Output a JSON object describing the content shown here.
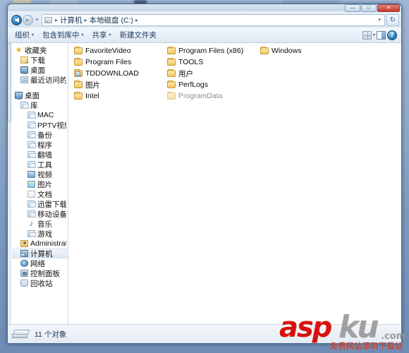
{
  "window": {
    "controls": {
      "minimize": "—",
      "maximize": "□",
      "close": "✕"
    }
  },
  "address": {
    "back_icon": "back-arrow-icon",
    "forward_icon": "forward-arrow-icon",
    "recent_caret": "▾",
    "drive_icon": "drive-icon",
    "crumbs": [
      "计算机",
      "本地磁盘 (C:)"
    ],
    "separator": "▸",
    "trailing_separator": "▸",
    "dropdown_caret": "▾",
    "refresh_label": "↻"
  },
  "toolbar": {
    "items": [
      {
        "label": "组织",
        "caret": "▾"
      },
      {
        "label": "包含到库中",
        "caret": "▾"
      },
      {
        "label": "共享",
        "caret": "▾"
      },
      {
        "label": "新建文件夹",
        "caret": ""
      }
    ],
    "view_caret": "▾",
    "help_label": "?"
  },
  "nav": {
    "items": [
      {
        "label": "收藏夹",
        "icon": "star-icon",
        "indent": 0,
        "selected": false
      },
      {
        "label": "下载",
        "icon": "download-icon",
        "indent": 1,
        "selected": false
      },
      {
        "label": "桌面",
        "icon": "monitor-icon",
        "indent": 1,
        "selected": false
      },
      {
        "label": "最近访问的位置",
        "icon": "recent-icon",
        "indent": 1,
        "selected": false
      },
      {
        "label": "__GAP__",
        "icon": "",
        "indent": 0,
        "selected": false
      },
      {
        "label": "桌面",
        "icon": "monitor-icon",
        "indent": 0,
        "selected": false
      },
      {
        "label": "库",
        "icon": "library-icon",
        "indent": 1,
        "selected": false
      },
      {
        "label": "MAC",
        "icon": "library-icon",
        "indent": 2,
        "selected": false
      },
      {
        "label": "PPTV视频",
        "icon": "library-icon",
        "indent": 2,
        "selected": false
      },
      {
        "label": "备份",
        "icon": "library-icon",
        "indent": 2,
        "selected": false
      },
      {
        "label": "程序",
        "icon": "library-icon",
        "indent": 2,
        "selected": false
      },
      {
        "label": "翻墙",
        "icon": "library-icon",
        "indent": 2,
        "selected": false
      },
      {
        "label": "工具",
        "icon": "library-icon",
        "indent": 2,
        "selected": false
      },
      {
        "label": "视频",
        "icon": "video-icon",
        "indent": 2,
        "selected": false
      },
      {
        "label": "图片",
        "icon": "picture-icon",
        "indent": 2,
        "selected": false
      },
      {
        "label": "文档",
        "icon": "document-icon",
        "indent": 2,
        "selected": false
      },
      {
        "label": "迅雷下载",
        "icon": "library-icon",
        "indent": 2,
        "selected": false
      },
      {
        "label": "移动设备",
        "icon": "library-icon",
        "indent": 2,
        "selected": false
      },
      {
        "label": "音乐",
        "icon": "music-icon",
        "indent": 2,
        "selected": false
      },
      {
        "label": "游戏",
        "icon": "library-icon",
        "indent": 2,
        "selected": false
      },
      {
        "label": "Administrator",
        "icon": "user-icon",
        "indent": 1,
        "selected": false
      },
      {
        "label": "计算机",
        "icon": "computer-icon",
        "indent": 1,
        "selected": true
      },
      {
        "label": "网络",
        "icon": "network-icon",
        "indent": 1,
        "selected": false
      },
      {
        "label": "控制面板",
        "icon": "control-panel-icon",
        "indent": 1,
        "selected": false
      },
      {
        "label": "回收站",
        "icon": "recycle-bin-icon",
        "indent": 1,
        "selected": false
      }
    ]
  },
  "files": {
    "items": [
      {
        "name": "FavoriteVideo",
        "icon": "folder-icon",
        "dimmed": false
      },
      {
        "name": "Program Files",
        "icon": "folder-icon",
        "dimmed": false
      },
      {
        "name": "TDDOWNLOAD",
        "icon": "folder-special-icon",
        "dimmed": false
      },
      {
        "name": "图片",
        "icon": "folder-icon",
        "dimmed": false
      },
      {
        "name": "Intel",
        "icon": "folder-icon",
        "dimmed": false
      },
      {
        "name": "Program Files (x86)",
        "icon": "folder-icon",
        "dimmed": false
      },
      {
        "name": "TOOLS",
        "icon": "folder-icon",
        "dimmed": false
      },
      {
        "name": "用户",
        "icon": "folder-icon",
        "dimmed": false
      },
      {
        "name": "PerfLogs",
        "icon": "folder-icon",
        "dimmed": false
      },
      {
        "name": "ProgramData",
        "icon": "folder-icon",
        "dimmed": true
      },
      {
        "name": "Windows",
        "icon": "folder-icon",
        "dimmed": false
      }
    ]
  },
  "status": {
    "text": "11 个对象",
    "drive_icon": "hard-drive-icon"
  },
  "watermark": {
    "asp": "asp",
    "ku": "ku",
    "com": ".com",
    "subtitle": "免费网站源码下载站"
  },
  "colors": {
    "accent_blue": "#2b6ea8",
    "close_red": "#c0392b",
    "folder_yellow": "#f0c862",
    "watermark_red": "#d8110f",
    "watermark_grey": "#9a9a9a"
  }
}
